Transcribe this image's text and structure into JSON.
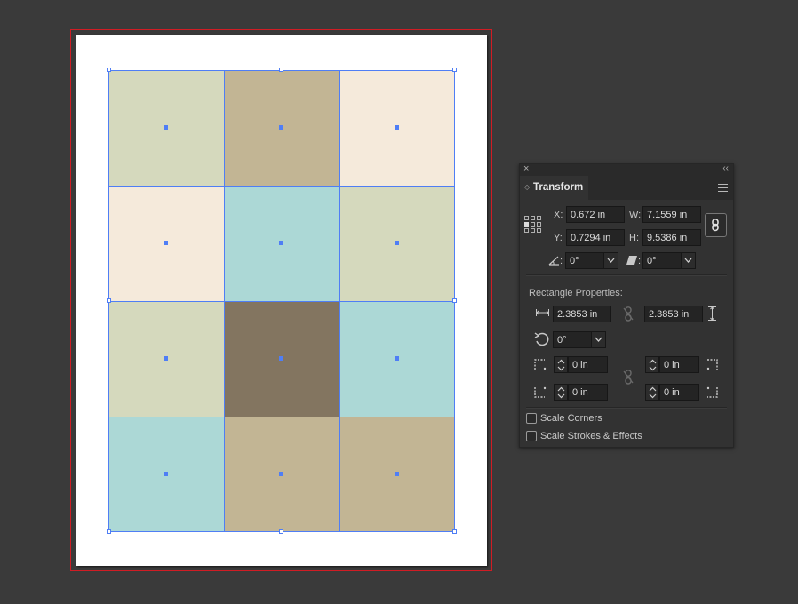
{
  "artboard": {
    "bleed_color": "#d01c24",
    "grid": {
      "rows": 4,
      "cols": 3,
      "colors": [
        [
          "#d5d9bd",
          "#c2b594",
          "#f5eadb"
        ],
        [
          "#f5eadb",
          "#acd8d6",
          "#d5d9bd"
        ],
        [
          "#d5d9bd",
          "#837560",
          "#acd8d6"
        ],
        [
          "#acd8d6",
          "#c2b594",
          "#c2b594"
        ]
      ]
    },
    "selection_color": "#4f7ef5"
  },
  "panel": {
    "close_icon": "×",
    "collapse_icon": "‹‹",
    "tab_label": "Transform",
    "x_label": "X:",
    "x_value": "0.672 in",
    "y_label": "Y:",
    "y_value": "0.7294 in",
    "w_label": "W:",
    "w_value": "7.1559 in",
    "h_label": "H:",
    "h_value": "9.5386 in",
    "rotate_label": ":",
    "rotate_value": "0°",
    "shear_label": ":",
    "shear_value": "0°",
    "rect_props_label": "Rectangle Properties:",
    "rect_width": "2.3853 in",
    "rect_height": "2.3853 in",
    "rect_rotate": "0°",
    "corner_tl": "0 in",
    "corner_tr": "0 in",
    "corner_bl": "0 in",
    "corner_br": "0 in",
    "scale_corners_label": "Scale Corners",
    "scale_strokes_label": "Scale Strokes & Effects",
    "scale_corners_checked": false,
    "scale_strokes_checked": false
  }
}
